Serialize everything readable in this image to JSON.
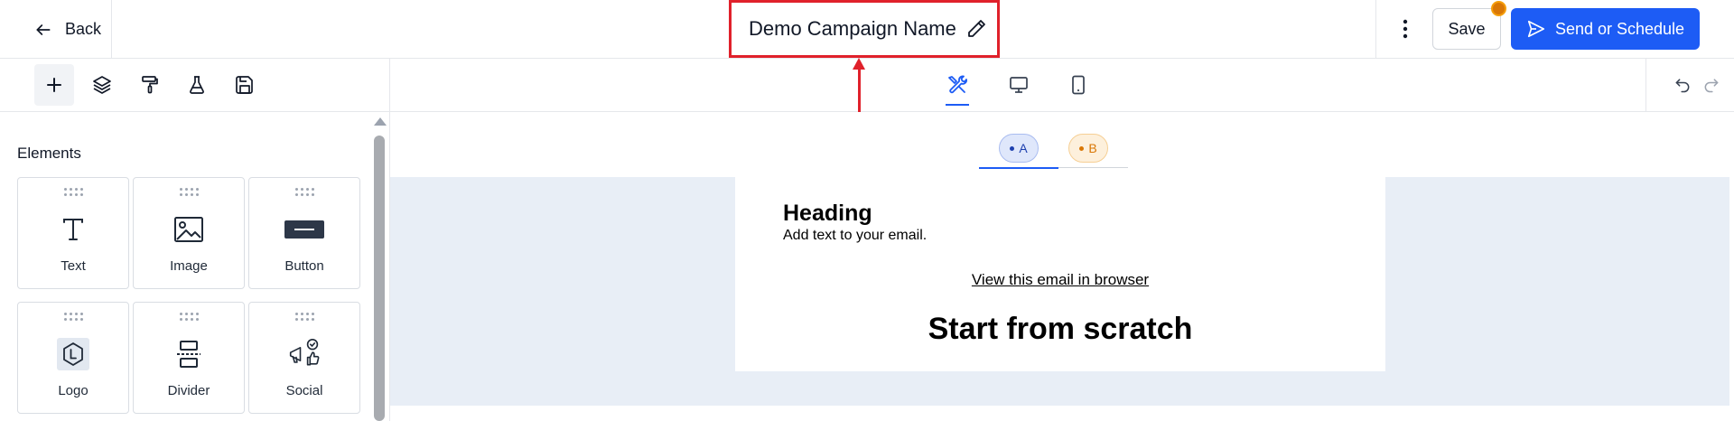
{
  "header": {
    "back_label": "Back",
    "campaign_name": "Demo Campaign Name",
    "save_label": "Save",
    "send_label": "Send or Schedule"
  },
  "toolbar": {
    "left_tools": [
      "plus-icon",
      "layers-icon",
      "paint-roller-icon",
      "flask-icon",
      "save-disk-icon"
    ],
    "view_tools": [
      "tools-icon",
      "desktop-icon",
      "mobile-icon"
    ],
    "active_view": "tools-icon"
  },
  "sidebar": {
    "title": "Elements",
    "elements": [
      {
        "label": "Text",
        "icon": "text-icon"
      },
      {
        "label": "Image",
        "icon": "image-icon"
      },
      {
        "label": "Button",
        "icon": "button-icon"
      },
      {
        "label": "Logo",
        "icon": "logo-icon"
      },
      {
        "label": "Divider",
        "icon": "divider-icon"
      },
      {
        "label": "Social",
        "icon": "social-icon"
      }
    ]
  },
  "canvas": {
    "variants": [
      {
        "label": "A",
        "active": true
      },
      {
        "label": "B",
        "active": false
      }
    ],
    "email": {
      "heading": "Heading",
      "subtext": "Add text to your email.",
      "link": "View this email in browser",
      "big_title": "Start from scratch"
    }
  },
  "colors": {
    "primary": "#1d5cf5",
    "annotation": "#e0212b",
    "notification": "#d97706",
    "canvas_bg": "#e8eef6"
  }
}
